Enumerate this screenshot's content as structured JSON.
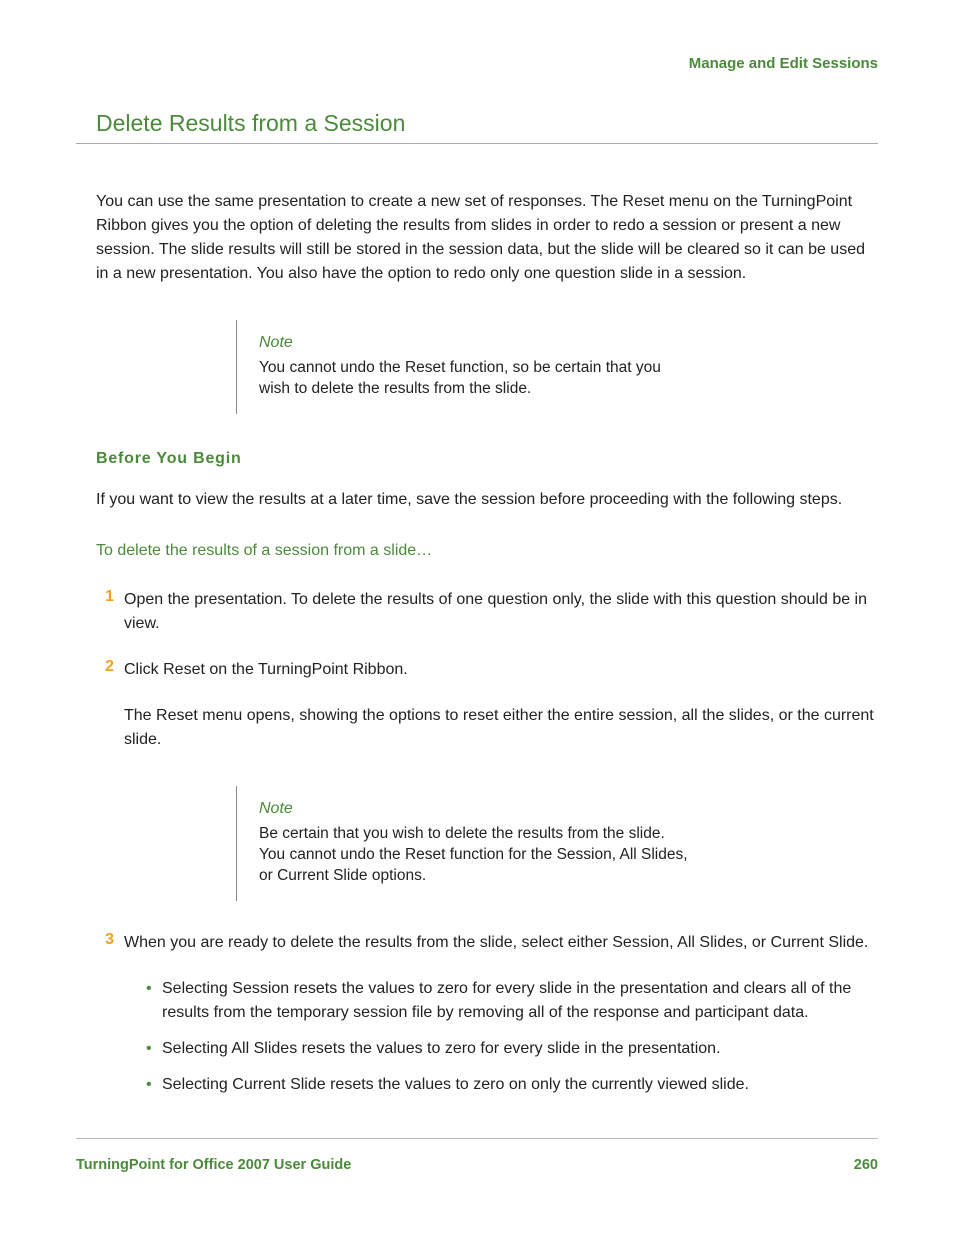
{
  "breadcrumb": "Manage and Edit Sessions",
  "section_title": "Delete Results from a Session",
  "intro": "You can use the same presentation to create a new set of responses. The Reset menu on the TurningPoint Ribbon gives you the option of deleting the results from slides in order to redo a session or present a new session. The slide results will still be stored in the session data, but the slide will be cleared so it can be used in a new presentation. You also have the option to redo only one question slide in a session.",
  "note1": {
    "label": "Note",
    "body": " You cannot undo the Reset function, so be certain that you wish to delete the results from the slide."
  },
  "before_heading": "Before You Begin",
  "before_text": "If you want to view the results at a later time, save the session before proceeding with the following steps.",
  "task_title": "To delete the results of a session from a slide…",
  "steps": [
    {
      "num": "1",
      "text": "Open the presentation. To delete the results of one question only, the slide with this question should be in view."
    },
    {
      "num": "2",
      "text": "Click Reset on the TurningPoint Ribbon."
    },
    {
      "num": "3",
      "text": "When you are ready to delete the results from the slide, select either Session, All Slides, or Current Slide."
    }
  ],
  "step2_extra": "The Reset menu opens, showing the options to reset either the entire session, all the slides, or the current slide.",
  "note2": {
    "label": "Note",
    "body": "Be certain that you wish to delete the results from the slide. You cannot undo the Reset function for the Session, All Slides, or Current Slide options."
  },
  "bullets": [
    "Selecting Session resets the values to zero for every slide in the presentation and clears all of the results from the temporary session file by removing all of the response and participant data.",
    "Selecting All Slides resets the values to zero for every slide in the presentation.",
    "Selecting Current Slide resets the values to zero on only the currently viewed slide."
  ],
  "footer": {
    "doc_title": "TurningPoint for Office 2007 User Guide",
    "page_num": "260"
  }
}
